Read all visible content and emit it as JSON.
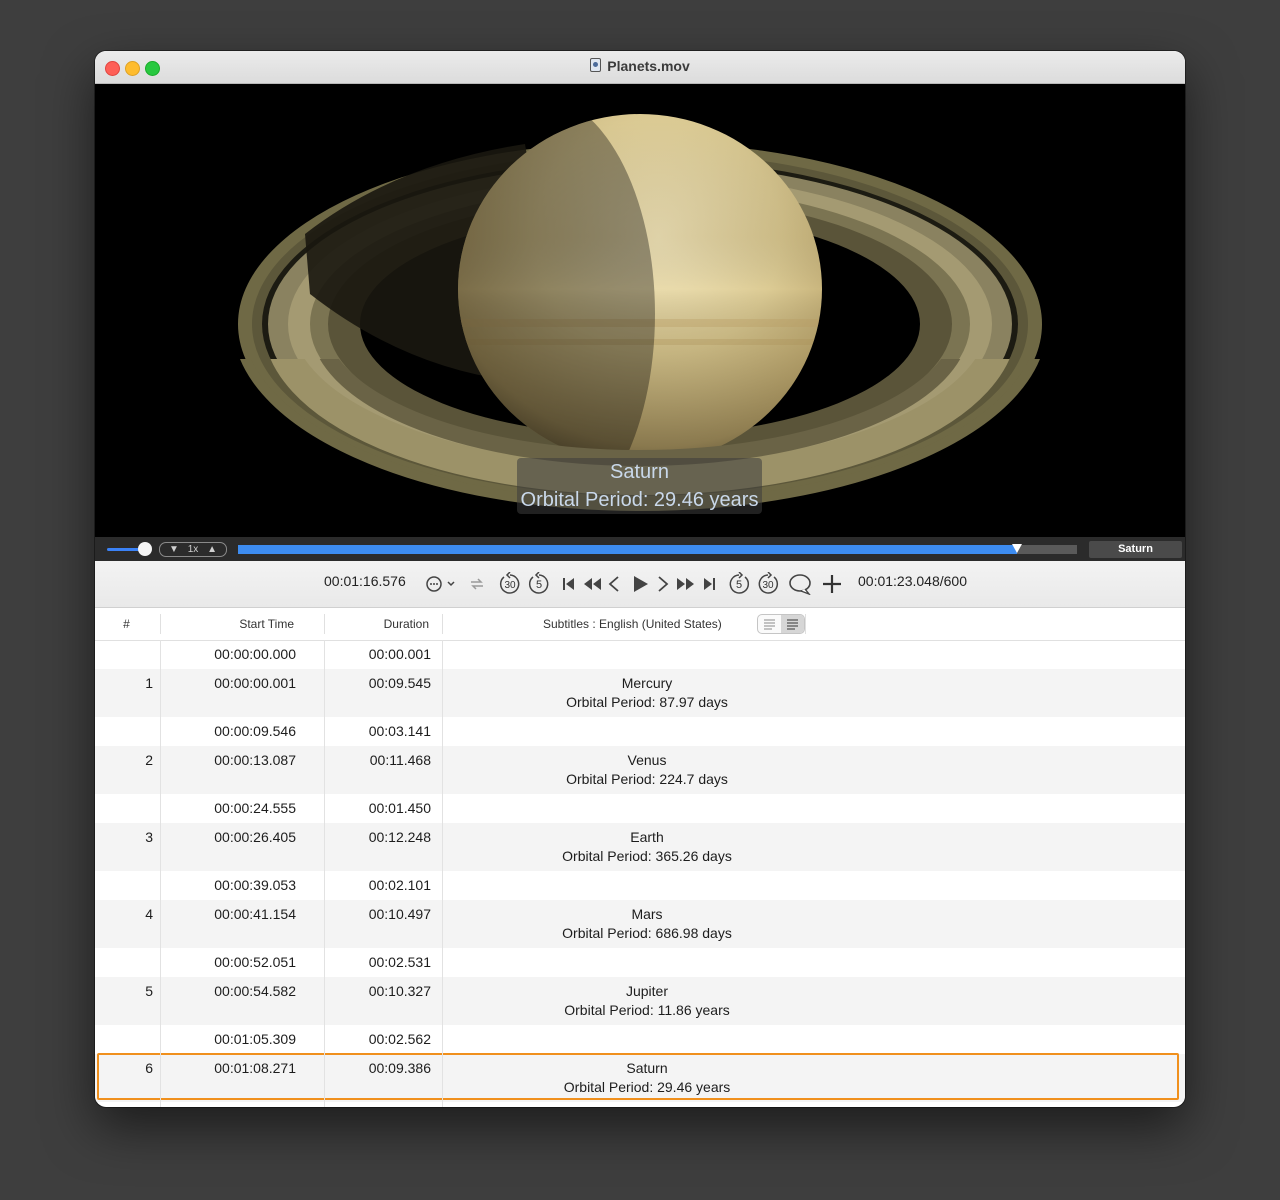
{
  "window": {
    "title": "Planets.mov",
    "file_icon": "movie-file-icon"
  },
  "video": {
    "subject": "saturn",
    "subtitle_overlay": [
      "Saturn",
      "Orbital Period: 29.46 years"
    ]
  },
  "scrubber": {
    "speed_label": "1x",
    "progress_fraction": 0.928,
    "volume_fraction": 0.8,
    "chapter_label": "Saturn"
  },
  "toolbar": {
    "current_time": "00:01:16.576",
    "total_time": "00:01:23.048/600",
    "controls": [
      "more-options-icon",
      "repeat-icon",
      "skip-back-30-icon",
      "skip-back-5-icon",
      "jump-to-start-icon",
      "rewind-icon",
      "step-back-icon",
      "play-icon",
      "step-forward-icon",
      "fast-forward-icon",
      "jump-to-end-icon",
      "skip-forward-5-icon",
      "skip-forward-30-icon",
      "add-subtitle-bubble-icon",
      "add-icon"
    ],
    "skip_back_30_label": "30",
    "skip_back_5_label": "5",
    "skip_fwd_5_label": "5",
    "skip_fwd_30_label": "30"
  },
  "table": {
    "headers": {
      "num": "#",
      "start": "Start Time",
      "duration": "Duration",
      "subtitles": "Subtitles : English (United States)"
    },
    "rows": [
      {
        "num": "",
        "start": "00:00:00.000",
        "duration": "00:00.001",
        "line1": "",
        "line2": ""
      },
      {
        "num": "1",
        "start": "00:00:00.001",
        "duration": "00:09.545",
        "line1": "Mercury",
        "line2": "Orbital Period: 87.97 days"
      },
      {
        "num": "",
        "start": "00:00:09.546",
        "duration": "00:03.141",
        "line1": "",
        "line2": ""
      },
      {
        "num": "2",
        "start": "00:00:13.087",
        "duration": "00:11.468",
        "line1": "Venus",
        "line2": "Orbital Period: 224.7 days"
      },
      {
        "num": "",
        "start": "00:00:24.555",
        "duration": "00:01.450",
        "line1": "",
        "line2": ""
      },
      {
        "num": "3",
        "start": "00:00:26.405",
        "duration": "00:12.248",
        "line1": "Earth",
        "line2": "Orbital Period: 365.26 days"
      },
      {
        "num": "",
        "start": "00:00:39.053",
        "duration": "00:02.101",
        "line1": "",
        "line2": ""
      },
      {
        "num": "4",
        "start": "00:00:41.154",
        "duration": "00:10.497",
        "line1": "Mars",
        "line2": "Orbital Period: 686.98 days"
      },
      {
        "num": "",
        "start": "00:00:52.051",
        "duration": "00:02.531",
        "line1": "",
        "line2": ""
      },
      {
        "num": "5",
        "start": "00:00:54.582",
        "duration": "00:10.327",
        "line1": "Jupiter",
        "line2": "Orbital Period: 11.86 years"
      },
      {
        "num": "",
        "start": "00:01:05.309",
        "duration": "00:02.562",
        "line1": "",
        "line2": ""
      },
      {
        "num": "6",
        "start": "00:01:08.271",
        "duration": "00:09.386",
        "line1": "Saturn",
        "line2": "Orbital Period: 29.46 years",
        "selected": true
      }
    ]
  },
  "colors": {
    "progress": "#3d8cf0",
    "selection_outline": "#f0901d",
    "subtitle_text": "#c9d8ea"
  }
}
